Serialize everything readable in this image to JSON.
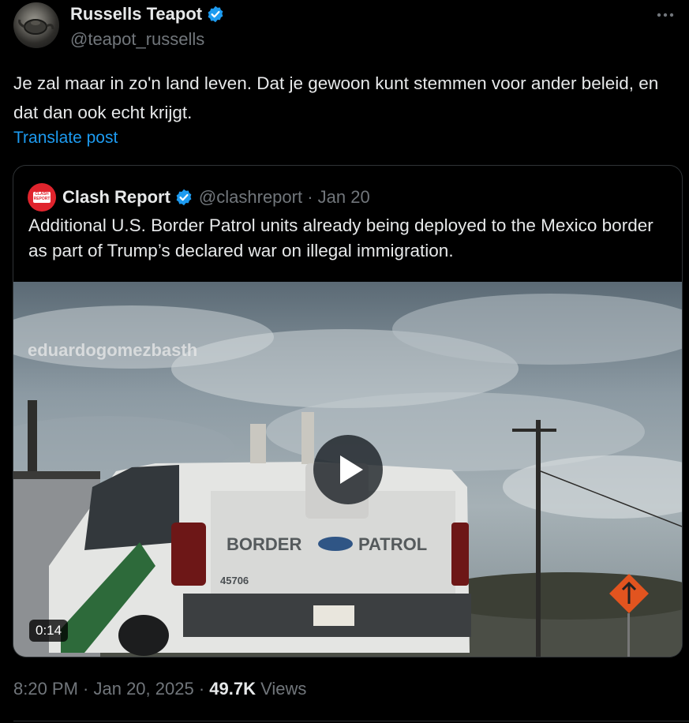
{
  "post": {
    "author": {
      "display_name": "Russells Teapot",
      "handle": "@teapot_russells",
      "verified": true
    },
    "text": "Je zal maar in zo'n land leven. Dat je gewoon kunt stemmen voor ander beleid, en dat dan ook echt krijgt.",
    "translate_label": "Translate post",
    "timestamp": "8:20 PM · Jan 20, 2025 ·",
    "views_count": "49.7K",
    "views_label": "Views"
  },
  "quoted_post": {
    "author": {
      "display_name": "Clash Report",
      "handle_and_date": "@clashreport · Jan 20",
      "verified": true
    },
    "text": "Additional U.S. Border Patrol units already being deployed to the Mexico border as part of Trump’s declared war on illegal immigration.",
    "media": {
      "type": "video",
      "watermark": "eduardogomezbasth",
      "duration": "0:14",
      "truck_text": "BORDER PATROL",
      "truck_number": "45706"
    }
  },
  "colors": {
    "background": "#000000",
    "text": "#e7e9ea",
    "muted": "#71767b",
    "link": "#1d9bf0",
    "verified": "#1d9bf0",
    "border": "#2f3336",
    "clash_red": "#e0242d"
  },
  "icons": {
    "verified": "verified-badge-icon",
    "more": "more-horizontal-icon",
    "play": "play-icon"
  }
}
